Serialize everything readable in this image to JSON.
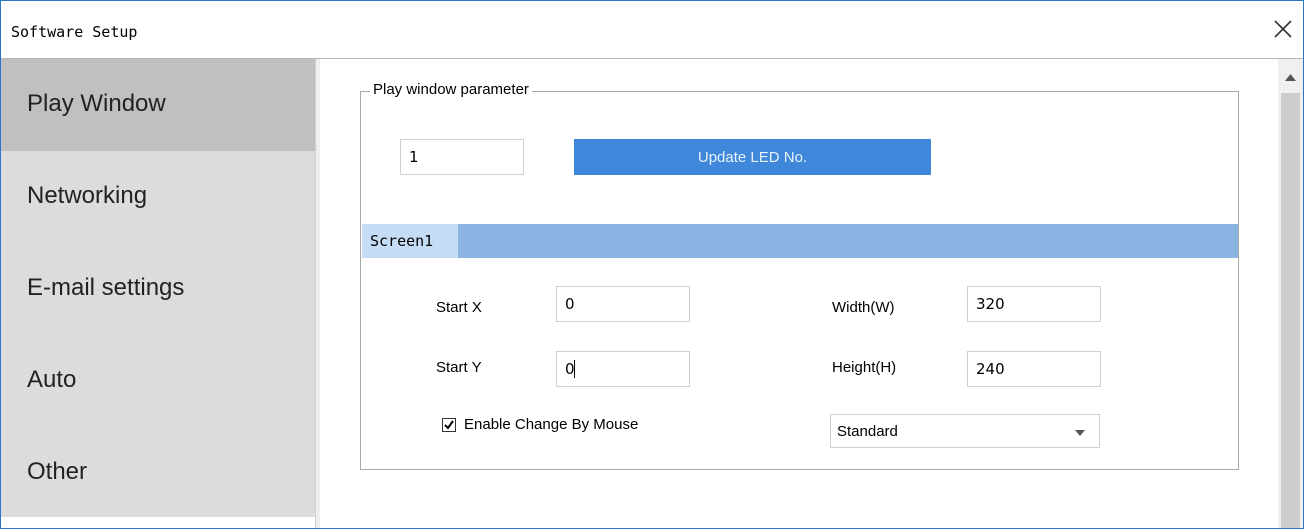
{
  "window": {
    "title": "Software Setup",
    "close_icon": "close-icon"
  },
  "sidebar": {
    "items": [
      {
        "label": "Play Window",
        "active": true
      },
      {
        "label": "Networking",
        "active": false
      },
      {
        "label": "E-mail settings",
        "active": false
      },
      {
        "label": "Auto",
        "active": false
      },
      {
        "label": "Other",
        "active": false
      }
    ]
  },
  "play_window": {
    "group_title": "Play window parameter",
    "led_no_value": "1",
    "update_button_label": "Update LED No.",
    "screen_tab_label": "Screen1",
    "start_x_label": "Start X",
    "start_x_value": "0",
    "start_y_label": "Start Y",
    "start_y_value": "0",
    "width_label": "Width(W)",
    "width_value": "320",
    "height_label": "Height(H)",
    "height_value": "240",
    "enable_mouse_label": "Enable Change By Mouse",
    "enable_mouse_checked": true,
    "mode_select_value": "Standard"
  },
  "colors": {
    "accent": "#3e87db",
    "screen_bar": "#8cb4e2",
    "screen_tab": "#c4ddf4",
    "sidebar_bg": "#dcdcdc",
    "sidebar_active": "#c0c0c0",
    "window_border": "#2b78c8"
  }
}
